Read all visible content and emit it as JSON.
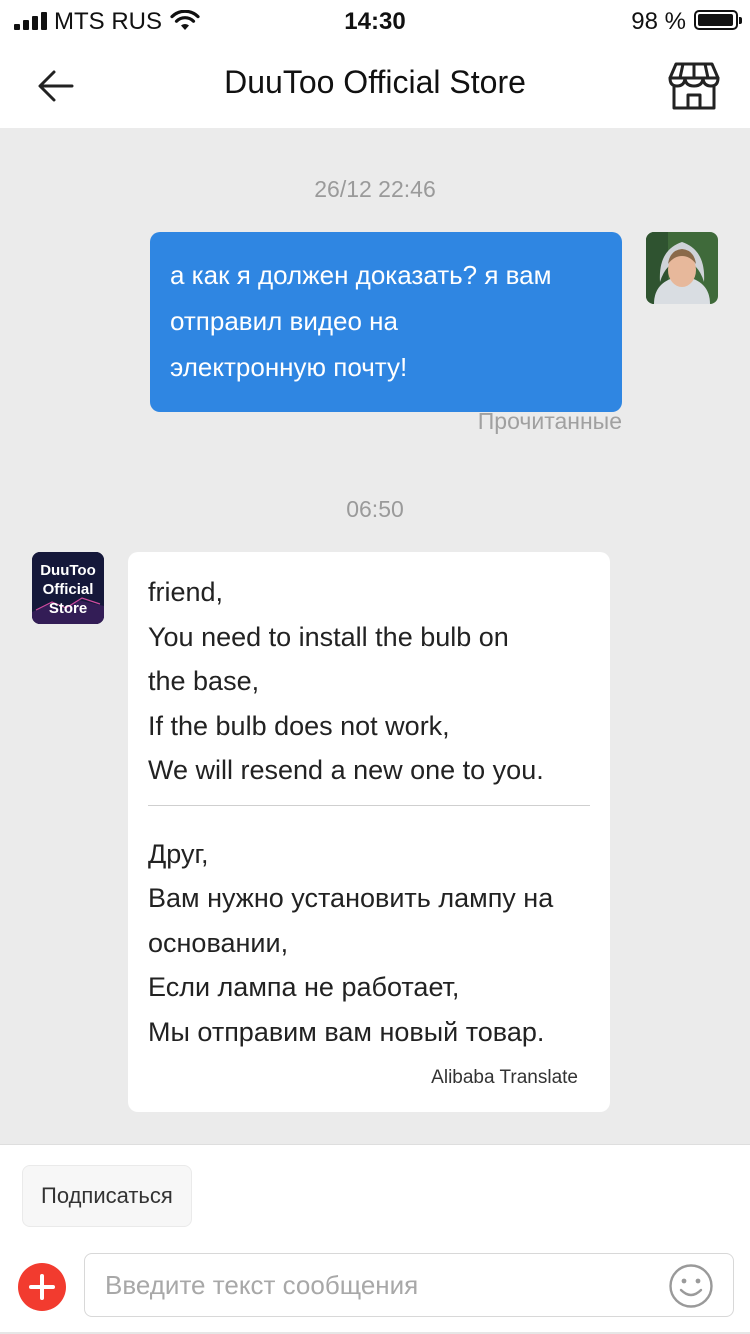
{
  "status_bar": {
    "carrier": "MTS RUS",
    "time": "14:30",
    "battery": "98 %",
    "battery_level": 0.98
  },
  "header": {
    "title": "DuuToo Official Store",
    "back_icon": "arrow-left-icon",
    "store_icon": "storefront-icon"
  },
  "chat": {
    "messages": [
      {
        "timestamp": "26/12 22:46",
        "direction": "outgoing",
        "lines": [
          "а как я должен доказать? я вам",
          "отправил видео на",
          "электронную почту!"
        ],
        "status": "Прочитанные"
      },
      {
        "timestamp": "06:50",
        "direction": "incoming",
        "original_lines": [
          "friend,",
          "You need to install the bulb on",
          "the base,",
          "If the bulb does not work,",
          "We will resend a new one to you."
        ],
        "translated_lines": [
          "Друг,",
          "Вам нужно установить лампу на",
          "основании,",
          "Если лампа не работает,",
          "Мы отправим вам новый товар."
        ],
        "translation_credit": "Alibaba Translate",
        "avatar_text": [
          "DuuToo",
          "Official",
          "Store"
        ]
      }
    ]
  },
  "composer": {
    "subscribe_label": "Подписаться",
    "input_placeholder": "Введите текст сообщения",
    "input_value": ""
  },
  "colors": {
    "accent_blue": "#2f86e2",
    "plus_red": "#f23b2f",
    "chat_bg": "#ebebeb"
  }
}
